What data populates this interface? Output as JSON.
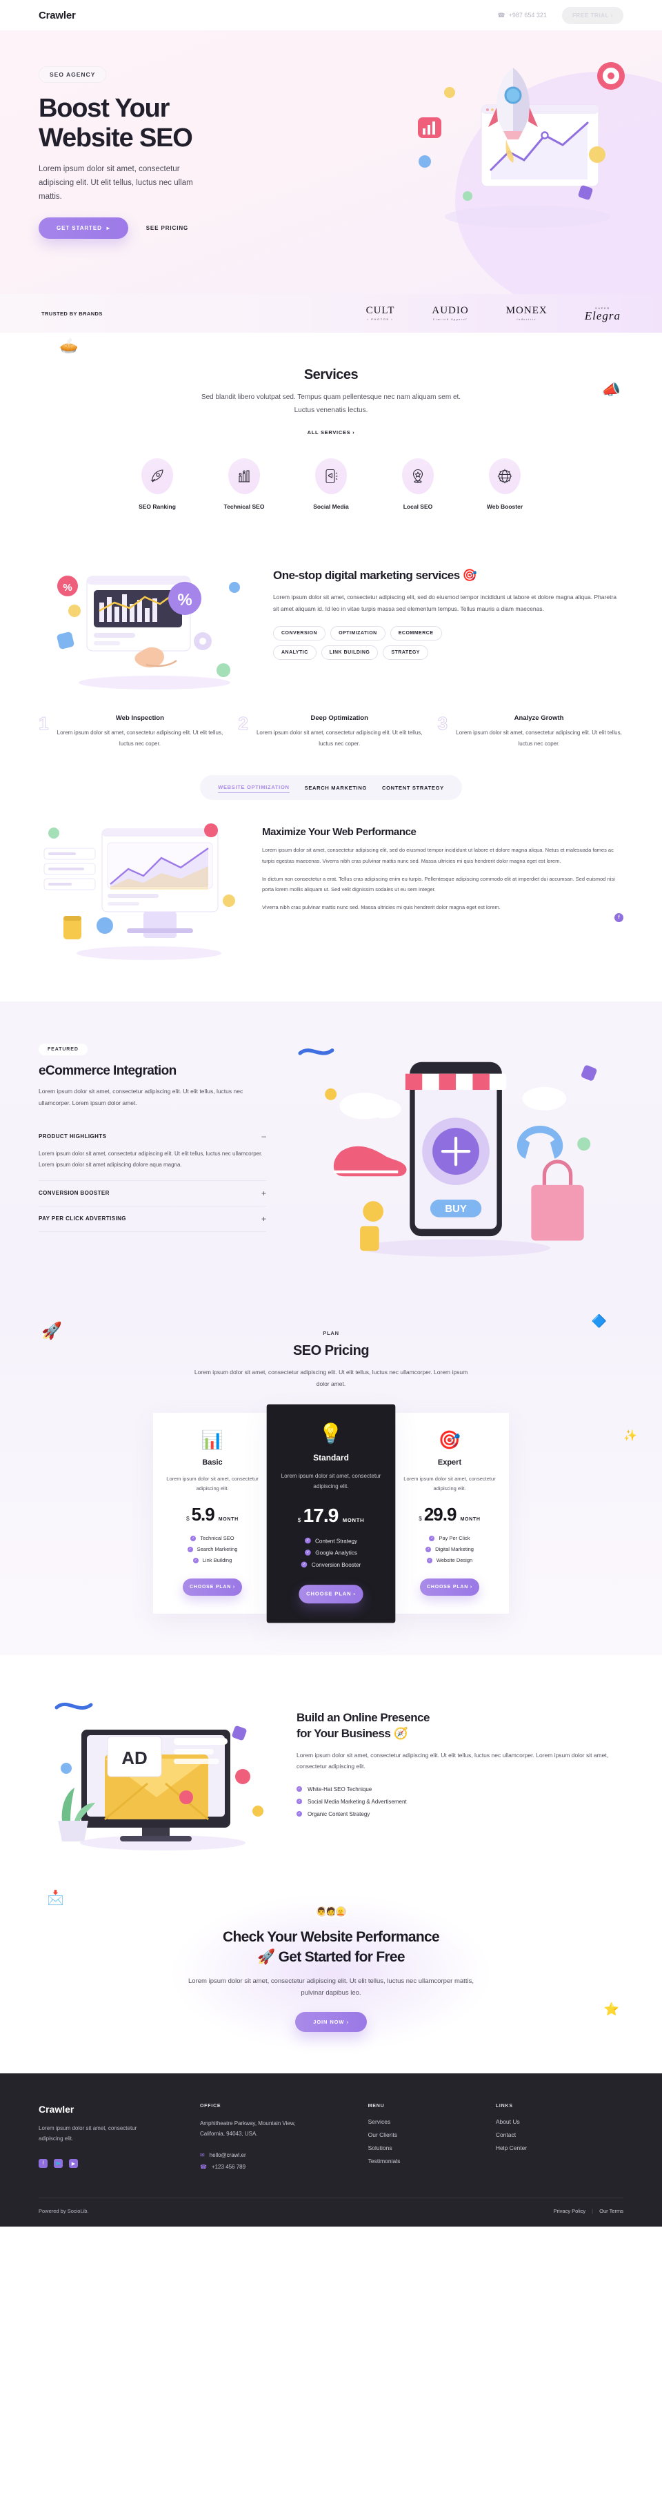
{
  "nav": {
    "brand": "Crawler",
    "phone": "+987 654 321",
    "phone_icon": "phone-icon",
    "trial_label": "FREE TRIAL  ›"
  },
  "hero": {
    "kicker": "SEO AGENCY",
    "title_line1": "Boost Your",
    "title_line2": "Website SEO",
    "subtitle": "Lorem ipsum dolor sit amet, consectetur adipiscing elit. Ut elit tellus, luctus nec ullam mattis.",
    "primary_cta": "GET STARTED",
    "secondary_cta": "SEE PRICING",
    "accent_color": "#9d7ae8"
  },
  "brands": {
    "label": "TRUSTED BY BRANDS",
    "items": [
      {
        "name": "CULT",
        "sub": "• PHOTOS •"
      },
      {
        "name": "AUDIO",
        "sub": "Limited Apparel"
      },
      {
        "name": "MONEX",
        "sub": "industrie"
      },
      {
        "name": "Elegra",
        "sub": "SUPER"
      }
    ]
  },
  "services": {
    "title": "Services",
    "subtitle": "Sed blandit libero volutpat sed. Tempus quam pellentesque nec nam aliquam sem et. Luctus venenatis lectus.",
    "cta": "ALL SERVICES  ›",
    "items": [
      {
        "label": "SEO Ranking",
        "icon": "rocket-icon"
      },
      {
        "label": "Technical SEO",
        "icon": "bar-chart-icon"
      },
      {
        "label": "Social Media",
        "icon": "megaphone-phone-icon"
      },
      {
        "label": "Local SEO",
        "icon": "map-pin-star-icon"
      },
      {
        "label": "Web Booster",
        "icon": "globe-gear-icon"
      }
    ]
  },
  "onestop": {
    "title": "One-stop digital marketing services 🎯",
    "paragraph": "Lorem ipsum dolor sit amet, consectetur adipiscing elit, sed do eiusmod tempor incididunt ut labore et dolore magna aliqua. Pharetra sit amet aliquam id. Id leo in vitae turpis massa sed elementum tempus. Tellus mauris a diam maecenas.",
    "tags": [
      "CONVERSION",
      "OPTIMIZATION",
      "ECOMMERCE",
      "ANALYTIC",
      "LINK BUILDING",
      "STRATEGY"
    ]
  },
  "steps": [
    {
      "num": "1",
      "title": "Web Inspection",
      "text": "Lorem ipsum dolor sit amet, consectetur adipiscing elit. Ut elit tellus, luctus nec coper."
    },
    {
      "num": "2",
      "title": "Deep Optimization",
      "text": "Lorem ipsum dolor sit amet, consectetur adipiscing elit. Ut elit tellus, luctus nec coper."
    },
    {
      "num": "3",
      "title": "Analyze Growth",
      "text": "Lorem ipsum dolor sit amet, consectetur adipiscing elit. Ut elit tellus, luctus nec coper."
    }
  ],
  "tabs": {
    "items": [
      "WEBSITE OPTIMIZATION",
      "SEARCH MARKETING",
      "CONTENT STRATEGY"
    ],
    "active_index": 0
  },
  "maximize": {
    "title": "Maximize Your Web Performance",
    "p1": "Lorem ipsum dolor sit amet, consectetur adipiscing elit, sed do eiusmod tempor incididunt ut labore et dolore magna aliqua. Netus et malesuada fames ac turpis egestas maecenas. Viverra nibh cras pulvinar mattis nunc sed. Massa ultricies mi quis hendrerit dolor magna eget est lorem.",
    "p2": "In dictum non consectetur a erat. Tellus cras adipiscing enim eu turpis. Pellentesque adipiscing commodo elit at imperdiet dui accumsan. Sed euismod nisi porta lorem mollis aliquam ut. Sed velit dignissim sodales ut eu sem integer.",
    "p3": "Viverra nibh cras pulvinar mattis nunc sed. Massa ultricies mi quis hendrerit dolor magna eget est lorem.",
    "badge": "f"
  },
  "ecommerce": {
    "kicker": "FEATURED",
    "title": "eCommerce Integration",
    "paragraph": "Lorem ipsum dolor sit amet, consectetur adipiscing elit. Ut elit tellus, luctus nec ullamcorper. Lorem ipsum dolor amet.",
    "accordion": [
      {
        "title": "PRODUCT HIGHLIGHTS",
        "sign": "–",
        "open": true,
        "body": "Lorem ipsum dolor sit amet, consectetur adipiscing elit. Ut elit tellus, luctus nec ullamcorper. Lorem ipsum dolor sit amet adipiscing dolore aqua magna."
      },
      {
        "title": "CONVERSION BOOSTER",
        "sign": "+",
        "open": false,
        "body": ""
      },
      {
        "title": "PAY PER CLICK ADVERTISING",
        "sign": "+",
        "open": false,
        "body": ""
      }
    ],
    "buy_button": "BUY"
  },
  "pricing": {
    "kicker": "PLAN",
    "title": "SEO Pricing",
    "subtitle": "Lorem ipsum dolor sit amet, consectetur adipiscing elit. Ut elit tellus, luctus nec ullamcorper. Lorem ipsum dolor amet.",
    "currency": "$",
    "period": "MONTH",
    "cta": "CHOOSE PLAN  ›",
    "plans": [
      {
        "emoji": "📊",
        "name": "Basic",
        "desc": "Lorem ipsum dolor sit amet, consectetur adipiscing elit.",
        "price": "5.9",
        "features": [
          "Technical SEO",
          "Search Marketing",
          "Link Building"
        ],
        "highlight": false
      },
      {
        "emoji": "💡",
        "name": "Standard",
        "desc": "Lorem ipsum dolor sit amet, consectetur adipiscing elit.",
        "price": "17.9",
        "features": [
          "Content Strategy",
          "Google Analytics",
          "Conversion Booster"
        ],
        "highlight": true
      },
      {
        "emoji": "🎯",
        "name": "Expert",
        "desc": "Lorem ipsum dolor sit amet, consectetur adipiscing elit.",
        "price": "29.9",
        "features": [
          "Pay Per Click",
          "Digital Marketing",
          "Website Design"
        ],
        "highlight": false
      }
    ]
  },
  "presence": {
    "title_line1": "Build an Online Presence",
    "title_line2": "for Your Business 🧭",
    "paragraph": "Lorem ipsum dolor sit amet, consectetur adipiscing elit. Ut elit tellus, luctus nec ullamcorper. Lorem ipsum dolor sit amet, consectetur adipiscing elit.",
    "features": [
      "White-Hat SEO Technique",
      "Social Media Marketing & Advertisement",
      "Organic Content Strategy"
    ],
    "art_label": "AD"
  },
  "cta": {
    "title_line1": "Check Your Website Performance",
    "title_line2": "🚀 Get Started for Free",
    "paragraph": "Lorem ipsum dolor sit amet, consectetur adipiscing elit. Ut elit tellus, luctus nec ullamcorper mattis, pulvinar dapibus leo.",
    "button": "JOIN NOW  ›",
    "avatars": [
      "👨",
      "🧑",
      "👱"
    ]
  },
  "footer": {
    "brand": "Crawler",
    "tagline": "Lorem ipsum dolor sit amet, consectetur adipiscing elit.",
    "socials": [
      {
        "name": "facebook-icon",
        "glyph": "f"
      },
      {
        "name": "twitter-icon",
        "glyph": "🐦"
      },
      {
        "name": "youtube-icon",
        "glyph": "▶"
      }
    ],
    "office": {
      "heading": "OFFICE",
      "address": "Amphitheatre Parkway, Mountain View, California, 94043, USA.",
      "email": "hello@crawl.er",
      "email_icon": "mail-icon",
      "phone": "+123 456 789",
      "phone_icon": "phone-icon"
    },
    "menu": {
      "heading": "MENU",
      "links": [
        "Services",
        "Our Clients",
        "Solutions",
        "Testimonials"
      ]
    },
    "links": {
      "heading": "LINKS",
      "links": [
        "About Us",
        "Contact",
        "Help Center"
      ]
    },
    "powered": "Powered by SocioLib.",
    "legal": {
      "privacy": "Privacy Policy",
      "sep": "|",
      "terms": "Our Terms"
    }
  }
}
